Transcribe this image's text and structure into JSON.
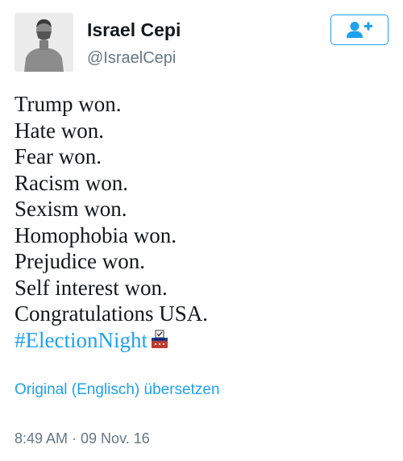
{
  "profile": {
    "display_name": "Israel Cepi",
    "handle": "@IsraelCepi"
  },
  "follow_button": {
    "icon": "add-user-icon",
    "accent_color": "#1da1f2"
  },
  "tweet": {
    "lines": [
      "Trump won.",
      "Hate won.",
      "Fear won.",
      "Racism won.",
      "Sexism won.",
      "Homophobia won.",
      "Prejudice won.",
      "Self interest won.",
      "Congratulations USA."
    ],
    "hashtag": "#ElectionNight",
    "hashtag_emoji": "ballot-box-icon"
  },
  "translate_label": "Original (Englisch) übersetzen",
  "timestamp": "8:49 AM · 09 Nov. 16",
  "colors": {
    "text": "#14171a",
    "secondary": "#657786",
    "link": "#1da1f2"
  }
}
